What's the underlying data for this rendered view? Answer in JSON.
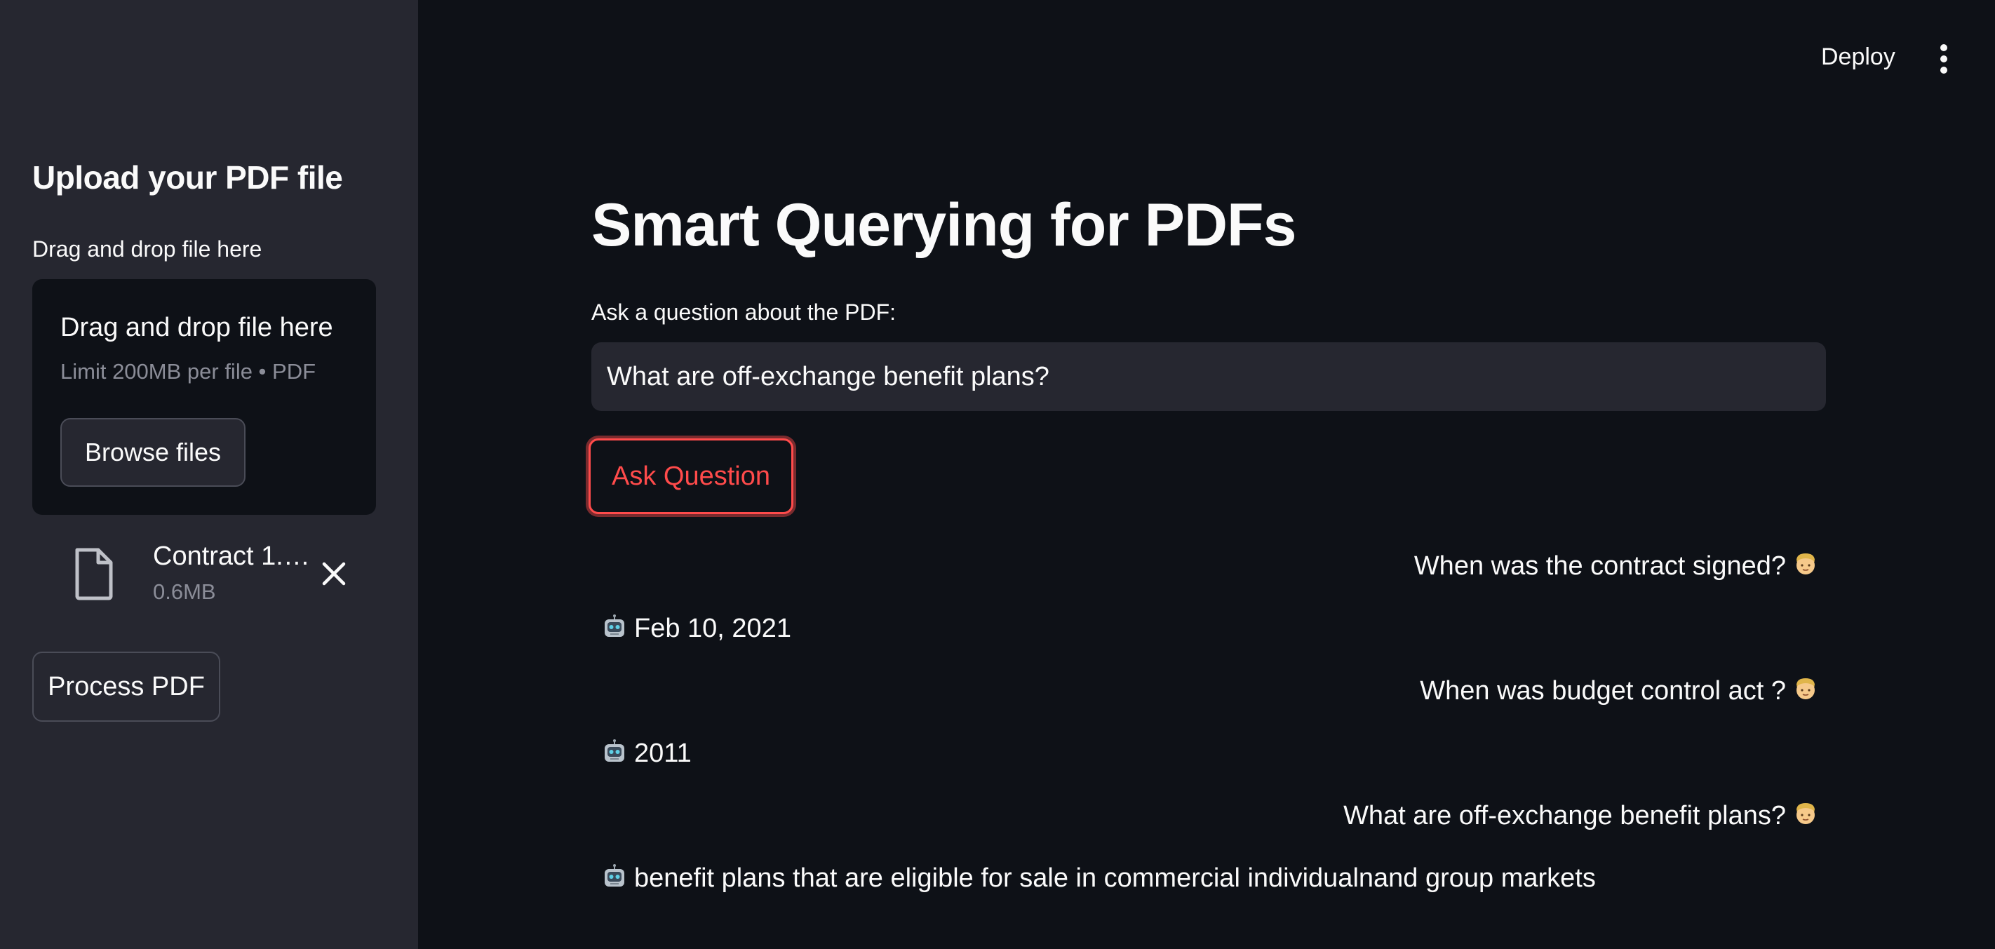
{
  "header": {
    "deploy_label": "Deploy",
    "menu_icon": "more-vertical-icon"
  },
  "sidebar": {
    "title": "Upload your PDF file",
    "uploader_label": "Drag and drop file here",
    "dropzone": {
      "title": "Drag and drop file here",
      "limit": "Limit 200MB per file • PDF",
      "browse_label": "Browse files"
    },
    "file": {
      "name": "Contract 1.…",
      "size": "0.6MB",
      "icon": "file-icon",
      "remove_icon": "close-icon"
    },
    "process_label": "Process PDF"
  },
  "main": {
    "title": "Smart Querying for PDFs",
    "question_label": "Ask a question about the PDF:",
    "question_value": "What are off-exchange benefit plans?",
    "ask_label": "Ask Question",
    "chat": [
      {
        "role": "user",
        "text": "When was the contract signed?",
        "icon": "user-emoji-icon"
      },
      {
        "role": "bot",
        "text": "Feb 10, 2021",
        "icon": "robot-emoji-icon"
      },
      {
        "role": "user",
        "text": "When was budget control act ?",
        "icon": "user-emoji-icon"
      },
      {
        "role": "bot",
        "text": "2011",
        "icon": "robot-emoji-icon"
      },
      {
        "role": "user",
        "text": "What are off-exchange benefit plans?",
        "icon": "user-emoji-icon"
      },
      {
        "role": "bot",
        "text": "benefit plans that are eligible for sale in commercial individualnand group markets",
        "icon": "robot-emoji-icon"
      }
    ]
  },
  "colors": {
    "background": "#0e1117",
    "sidebar": "#262730",
    "accent": "#ff4b4b",
    "muted_text": "#8b8d98"
  }
}
